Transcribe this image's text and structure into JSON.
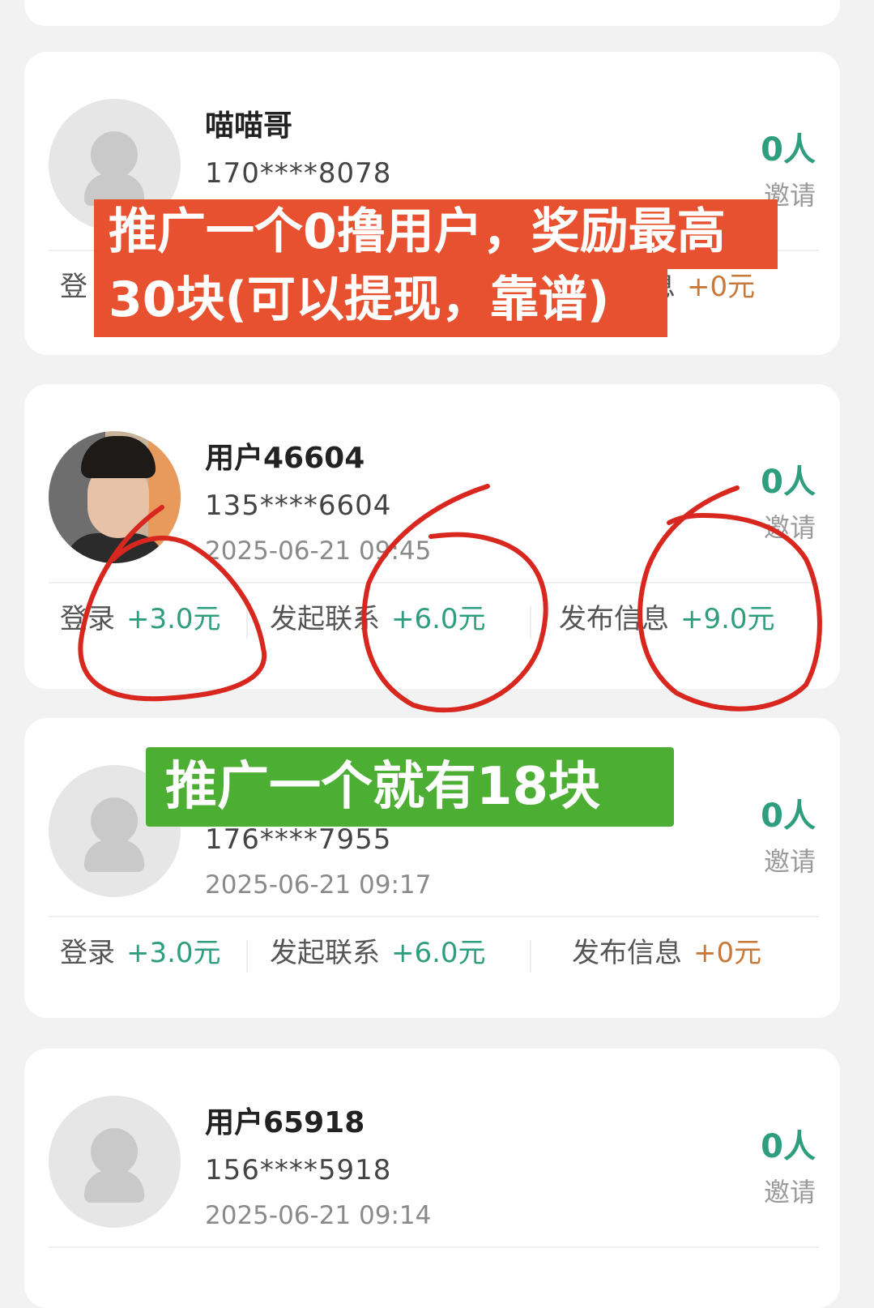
{
  "users": [
    {
      "name": "喵喵哥",
      "phone": "170****8078",
      "date": "",
      "count": "0人",
      "invite_label": "邀请",
      "stats": [
        {
          "label": "登",
          "value": ""
        },
        {
          "label": "",
          "value": ""
        },
        {
          "label": "息",
          "value": "+0元"
        }
      ]
    },
    {
      "name": "用户46604",
      "phone": "135****6604",
      "date": "2025-06-21 09:45",
      "count": "0人",
      "invite_label": "邀请",
      "stats": [
        {
          "label": "登录",
          "value": "+3.0元"
        },
        {
          "label": "发起联系",
          "value": "+6.0元"
        },
        {
          "label": "发布信息",
          "value": "+9.0元"
        }
      ]
    },
    {
      "name": "",
      "phone": "176****7955",
      "date": "2025-06-21 09:17",
      "count": "0人",
      "invite_label": "邀请",
      "stats": [
        {
          "label": "登录",
          "value": "+3.0元"
        },
        {
          "label": "发起联系",
          "value": "+6.0元"
        },
        {
          "label": "发布信息",
          "value": "+0元"
        }
      ]
    },
    {
      "name": "用户65918",
      "phone": "156****5918",
      "date": "2025-06-21 09:14",
      "count": "0人",
      "invite_label": "邀请"
    }
  ],
  "overlays": {
    "red_banner_line1": "推广一个0撸用户，奖励最高",
    "red_banner_line2": "30块(可以提现，靠谱)",
    "green_banner": "推广一个就有18块"
  },
  "colors": {
    "accent_green": "#2f9e7e",
    "reward_orange": "#c8793a",
    "banner_red": "#e8512f",
    "banner_green": "#4caf34",
    "scribble_red": "#d8271f"
  },
  "icons": {
    "default_avatar": "person-placeholder-icon"
  }
}
